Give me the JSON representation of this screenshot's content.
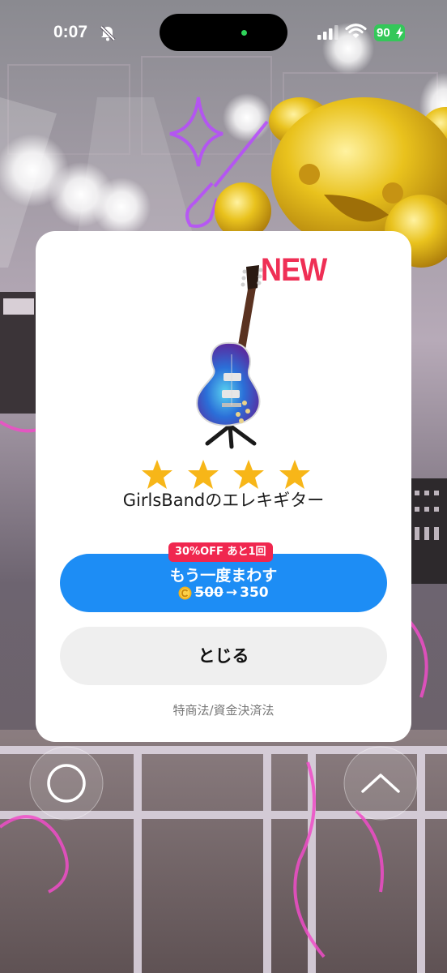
{
  "status_bar": {
    "time": "0:07",
    "battery": "90"
  },
  "dialog": {
    "badge": "NEW",
    "rating": 4,
    "item_name": "GirlsBandのエレキギター",
    "spin_again": {
      "discount_badge": "30%OFF あと1回",
      "label": "もう一度まわす",
      "old_price": "500",
      "arrow": "→",
      "new_price": "350"
    },
    "close_label": "とじる",
    "legal_link": "特商法/資金決済法"
  },
  "colors": {
    "primary_button": "#1d8df5",
    "badge_red": "#f0274f",
    "new_pink": "#ef2f55",
    "star_gold": "#f7b618"
  }
}
